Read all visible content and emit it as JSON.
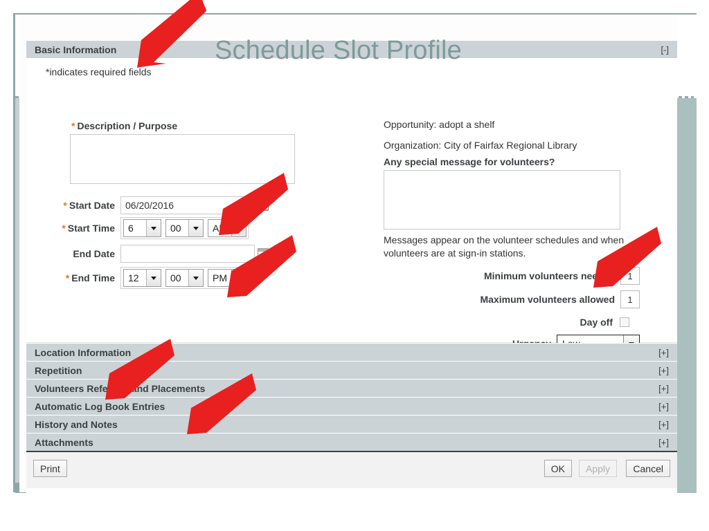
{
  "page_title": "Schedule Slot Profile",
  "sections": {
    "basic": {
      "title": "Basic Information",
      "toggle": "[-]",
      "required_note": "*indicates required fields"
    },
    "collapsed": [
      {
        "title": "Location Information",
        "toggle": "[+]"
      },
      {
        "title": "Repetition",
        "toggle": "[+]"
      },
      {
        "title": "Volunteers Referrals and Placements",
        "toggle": "[+]"
      },
      {
        "title": "Automatic Log Book Entries",
        "toggle": "[+]"
      },
      {
        "title": "History and Notes",
        "toggle": "[+]"
      },
      {
        "title": "Attachments",
        "toggle": "[+]"
      }
    ]
  },
  "form": {
    "star": "*",
    "description_label": "Description / Purpose",
    "description_value": "",
    "start_date_label": "Start Date",
    "start_date_value": "06/20/2016",
    "start_time_label": "Start Time",
    "start_time_hour": "6",
    "start_time_minute": "00",
    "start_time_meridiem": "AM",
    "end_date_label": "End Date",
    "end_date_value": "",
    "end_time_label": "End Time",
    "end_time_hour": "12",
    "end_time_minute": "00",
    "end_time_meridiem": "PM"
  },
  "details": {
    "opportunity": "Opportunity: adopt a shelf",
    "organization": "Organization: City of Fairfax Regional Library",
    "message_label": "Any special message for volunteers?",
    "message_value": "",
    "message_help": "Messages appear on the volunteer schedules and when volunteers are at sign-in stations.",
    "min_volunteers_label": "Minimum volunteers needed",
    "min_volunteers_value": "1",
    "max_volunteers_label": "Maximum volunteers allowed",
    "max_volunteers_value": "1",
    "day_off_label": "Day off",
    "day_off_checked": false,
    "urgency_label": "Urgency",
    "urgency_value": "Low"
  },
  "footer": {
    "print": "Print",
    "ok": "OK",
    "apply": "Apply",
    "cancel": "Cancel"
  },
  "colors": {
    "accent_title": "#7e9a99",
    "section_bar": "#ccd3d6",
    "required_star": "#e8721f",
    "arrow_red": "#e8201f",
    "frame_band": "#8ba8a4"
  },
  "annotations": {
    "arrow_count": 7,
    "arrow_color": "#e8201f"
  }
}
